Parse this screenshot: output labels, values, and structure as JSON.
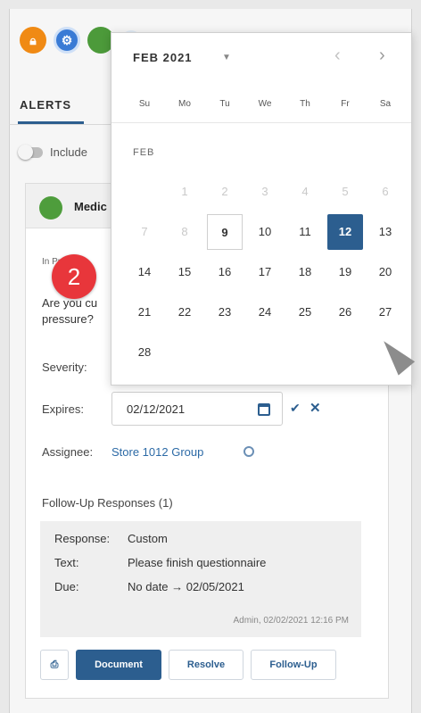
{
  "top_icons": [
    "lock-icon",
    "gear-icon",
    "profile-icon",
    "extra-icon"
  ],
  "tabs": {
    "alerts": "ALERTS"
  },
  "filters": {
    "include_label": "Include"
  },
  "card": {
    "title": "Medic",
    "status": "In Progress",
    "badge": "2",
    "question": "Are you cu pressure?",
    "severity_label": "Severity:",
    "expires_label": "Expires:",
    "expires_value": "02/12/2021",
    "assignee_label": "Assignee:",
    "assignee_value": "Store 1012 Group",
    "followup_title": "Follow-Up Responses (1)",
    "followup": {
      "response_key": "Response:",
      "response_val": "Custom",
      "text_key": "Text:",
      "text_val": "Please finish questionnaire",
      "due_key": "Due:",
      "due_val": "No date → 02/05/2021",
      "meta": "Admin, 02/02/2021 12:16 PM"
    },
    "actions": {
      "document": "Document",
      "resolve": "Resolve",
      "follow_up": "Follow-Up"
    }
  },
  "calendar": {
    "month_label": "FEB 2021",
    "subhead": "FEB",
    "dow": [
      "Su",
      "Mo",
      "Tu",
      "We",
      "Th",
      "Fr",
      "Sa"
    ],
    "weeks": [
      [
        "",
        "1",
        "2",
        "3",
        "4",
        "5",
        "6"
      ],
      [
        "7",
        "8",
        "9",
        "10",
        "11",
        "12",
        "13"
      ],
      [
        "14",
        "15",
        "16",
        "17",
        "18",
        "19",
        "20"
      ],
      [
        "21",
        "22",
        "23",
        "24",
        "25",
        "26",
        "27"
      ],
      [
        "28",
        "",
        "",
        "",
        "",
        "",
        ""
      ]
    ],
    "today": "9",
    "selected": "12",
    "disabled_before": 9
  }
}
